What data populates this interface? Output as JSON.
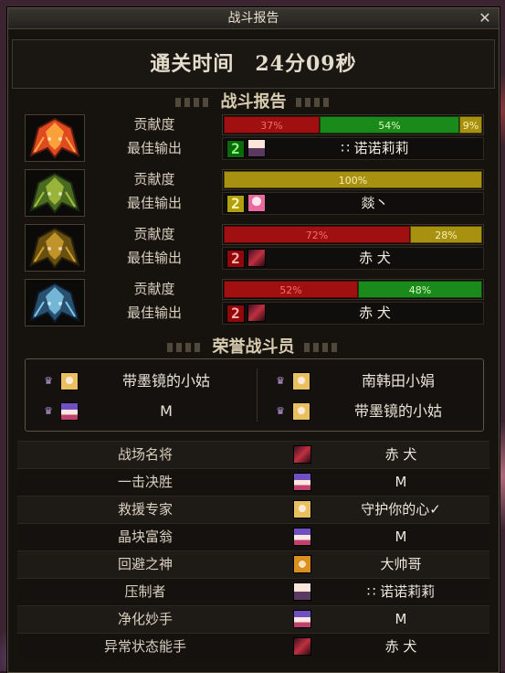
{
  "window": {
    "title": "战斗报告",
    "close_glyph": "✕"
  },
  "clear_time": "通关时间　24分09秒",
  "sections": {
    "report_title": "战斗报告",
    "honor_title": "荣誉战斗员"
  },
  "labels": {
    "contribution": "贡献度",
    "best_output": "最佳输出"
  },
  "bosses": [
    {
      "icon": "flame-helmet-icon",
      "contribution": [
        {
          "percent": 37,
          "label": "37%",
          "color": "red"
        },
        {
          "percent": 54,
          "label": "54%",
          "color": "green"
        },
        {
          "percent": 9,
          "label": "9%",
          "color": "gold"
        }
      ],
      "best": {
        "rank_color": "green",
        "rank_glyph": "2",
        "avatar": "girl",
        "name": "∷ 诺诺莉莉"
      }
    },
    {
      "icon": "green-horn-helmet-icon",
      "contribution": [
        {
          "percent": 100,
          "label": "100%",
          "color": "gold"
        }
      ],
      "best": {
        "rank_color": "yellow",
        "rank_glyph": "2",
        "avatar": "pink",
        "name": "燚丶"
      }
    },
    {
      "icon": "gold-helmet-icon",
      "contribution": [
        {
          "percent": 72,
          "label": "72%",
          "color": "red"
        },
        {
          "percent": 28,
          "label": "28%",
          "color": "gold"
        }
      ],
      "best": {
        "rank_color": "red",
        "rank_glyph": "2",
        "avatar": "dark",
        "name": "赤 犬"
      }
    },
    {
      "icon": "ice-helmet-icon",
      "contribution": [
        {
          "percent": 52,
          "label": "52%",
          "color": "red"
        },
        {
          "percent": 48,
          "label": "48%",
          "color": "green"
        }
      ],
      "best": {
        "rank_color": "red",
        "rank_glyph": "2",
        "avatar": "dark",
        "name": "赤 犬"
      }
    }
  ],
  "honor": [
    {
      "avatar": "blonde",
      "name": "带墨镜的小姑"
    },
    {
      "avatar": "blonde",
      "name": "南韩田小娟"
    },
    {
      "avatar": "wiz",
      "name": "M"
    },
    {
      "avatar": "blonde",
      "name": "带墨镜的小姑"
    }
  ],
  "awards": [
    {
      "title": "战场名将",
      "avatar": "dark",
      "player": "赤 犬"
    },
    {
      "title": "一击决胜",
      "avatar": "wiz",
      "player": "M"
    },
    {
      "title": "救援专家",
      "avatar": "blonde",
      "player": "守护你的心✓"
    },
    {
      "title": "晶块富翁",
      "avatar": "wiz",
      "player": "M"
    },
    {
      "title": "回避之神",
      "avatar": "fox",
      "player": "大帅哥"
    },
    {
      "title": "压制者",
      "avatar": "girl",
      "player": "∷ 诺诺莉莉"
    },
    {
      "title": "净化妙手",
      "avatar": "wiz",
      "player": "M"
    },
    {
      "title": "异常状态能手",
      "avatar": "dark",
      "player": "赤 犬"
    }
  ]
}
